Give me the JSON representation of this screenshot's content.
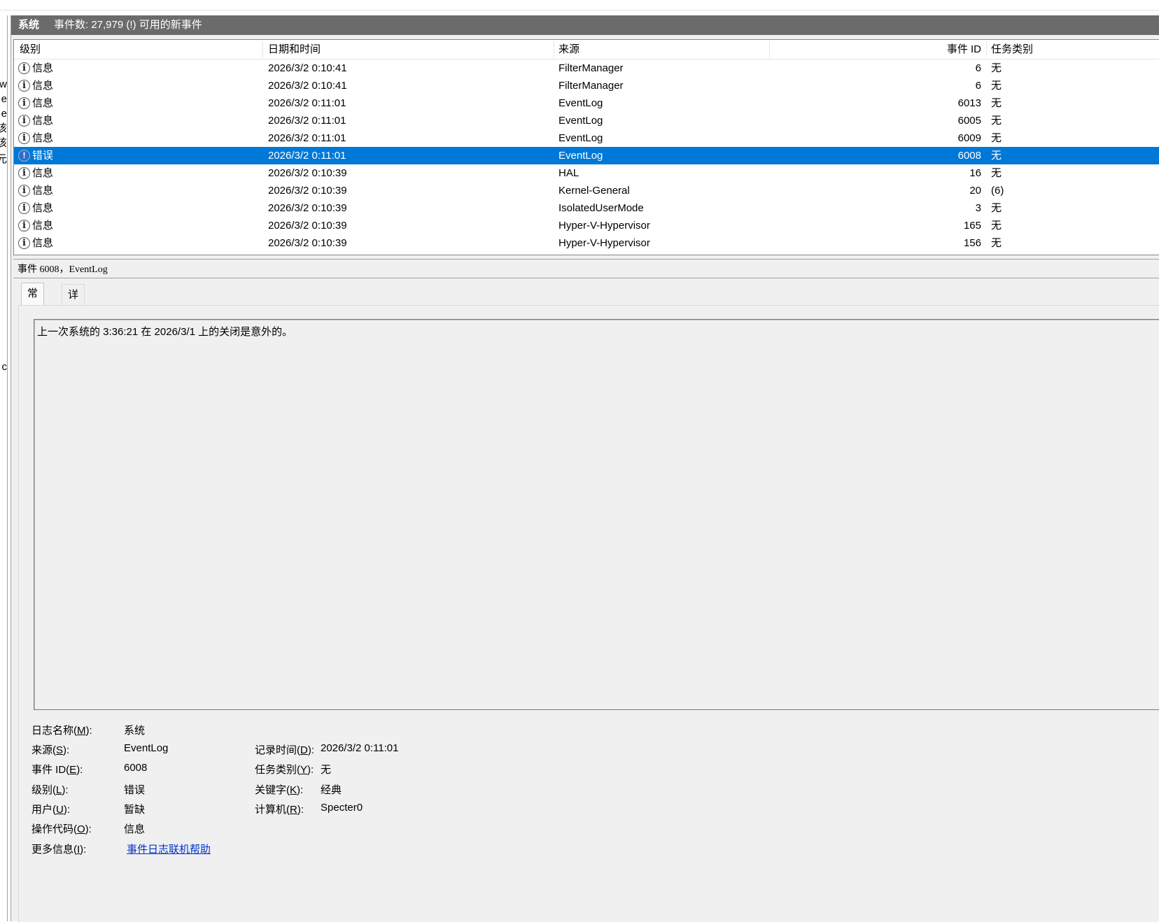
{
  "left_pane": {
    "fragments": [
      "w",
      "e",
      "e",
      "该",
      "该",
      "元",
      "c"
    ]
  },
  "titlebar": {
    "title": "系统",
    "count": "事件数: 27,979 (!) 可用的新事件"
  },
  "columns": {
    "level": "级别",
    "date": "日期和时间",
    "source": "来源",
    "event_id": "事件 ID",
    "task": "任务类别"
  },
  "events": [
    {
      "level": "信息",
      "icon": "info-icon",
      "date": "2026/3/2 0:10:41",
      "source": "FilterManager",
      "id": "6",
      "task": "无"
    },
    {
      "level": "信息",
      "icon": "info-icon",
      "date": "2026/3/2 0:10:41",
      "source": "FilterManager",
      "id": "6",
      "task": "无"
    },
    {
      "level": "信息",
      "icon": "info-icon",
      "date": "2026/3/2 0:11:01",
      "source": "EventLog",
      "id": "6013",
      "task": "无"
    },
    {
      "level": "信息",
      "icon": "info-icon",
      "date": "2026/3/2 0:11:01",
      "source": "EventLog",
      "id": "6005",
      "task": "无"
    },
    {
      "level": "信息",
      "icon": "info-icon",
      "date": "2026/3/2 0:11:01",
      "source": "EventLog",
      "id": "6009",
      "task": "无"
    },
    {
      "level": "错误",
      "icon": "error-icon",
      "date": "2026/3/2 0:11:01",
      "source": "EventLog",
      "id": "6008",
      "task": "无",
      "selected": true
    },
    {
      "level": "信息",
      "icon": "info-icon",
      "date": "2026/3/2 0:10:39",
      "source": "HAL",
      "id": "16",
      "task": "无"
    },
    {
      "level": "信息",
      "icon": "info-icon",
      "date": "2026/3/2 0:10:39",
      "source": "Kernel-General",
      "id": "20",
      "task": "(6)"
    },
    {
      "level": "信息",
      "icon": "info-icon",
      "date": "2026/3/2 0:10:39",
      "source": "IsolatedUserMode",
      "id": "3",
      "task": "无"
    },
    {
      "level": "信息",
      "icon": "info-icon",
      "date": "2026/3/2 0:10:39",
      "source": "Hyper-V-Hypervisor",
      "id": "165",
      "task": "无"
    },
    {
      "level": "信息",
      "icon": "info-icon",
      "date": "2026/3/2 0:10:39",
      "source": "Hyper-V-Hypervisor",
      "id": "156",
      "task": "无"
    }
  ],
  "detail": {
    "header": "事件 6008，EventLog",
    "tabs": {
      "general": "常规",
      "details": "详细信息"
    },
    "message": "上一次系统的 3:36:21 在 2026/3/1 上的关闭是意外的。",
    "labels": {
      "log_name": {
        "pre": "日志名称(",
        "key": "M",
        "post": "):"
      },
      "source": {
        "pre": "来源(",
        "key": "S",
        "post": "):"
      },
      "event_id": {
        "pre": "事件 ID(",
        "key": "E",
        "post": "):"
      },
      "level": {
        "pre": "级别(",
        "key": "L",
        "post": "):"
      },
      "user": {
        "pre": "用户(",
        "key": "U",
        "post": "):"
      },
      "opcode": {
        "pre": "操作代码(",
        "key": "O",
        "post": "):"
      },
      "more_info": {
        "pre": "更多信息(",
        "key": "I",
        "post": "):"
      },
      "logged": {
        "pre": "记录时间(",
        "key": "D",
        "post": "):"
      },
      "task": {
        "pre": "任务类别(",
        "key": "Y",
        "post": "):"
      },
      "keywords": {
        "pre": "关键字(",
        "key": "K",
        "post": "):"
      },
      "computer": {
        "pre": "计算机(",
        "key": "R",
        "post": "):"
      }
    },
    "values": {
      "log_name": "系统",
      "source": "EventLog",
      "event_id": "6008",
      "level": "错误",
      "user": "暂缺",
      "opcode": "信息",
      "more_info": "事件日志联机帮助",
      "logged": "2026/3/2 0:11:01",
      "task": "无",
      "keywords": "经典",
      "computer": "Specter0"
    }
  },
  "colors": {
    "selection": "#0078d7",
    "titlebar": "#6b6b6b",
    "link": "#0033cc"
  }
}
